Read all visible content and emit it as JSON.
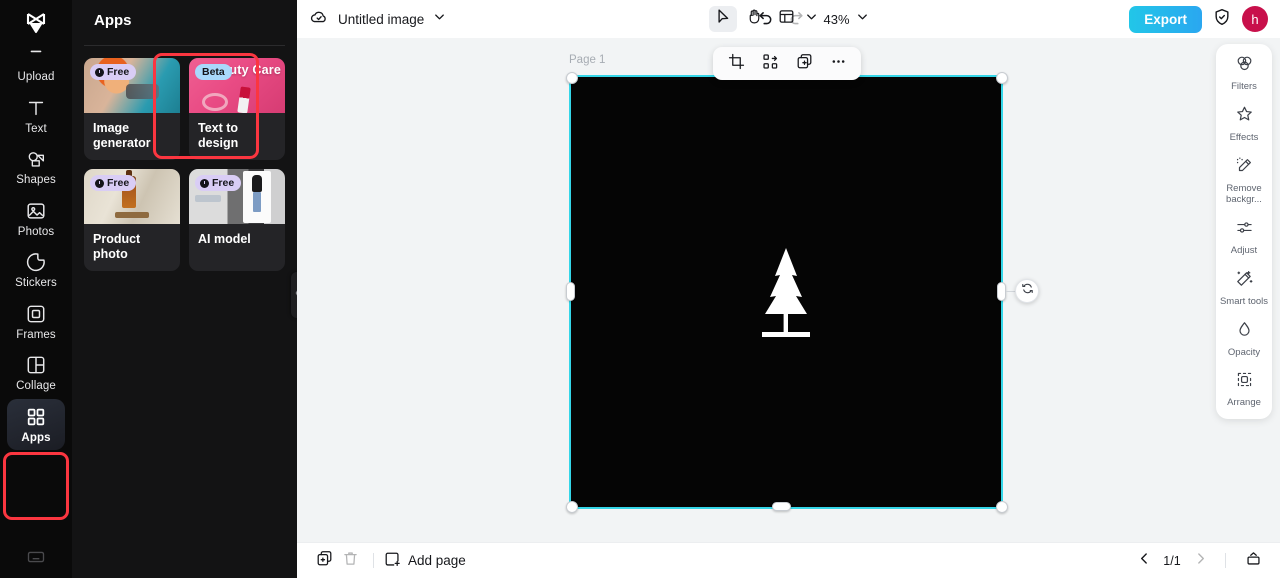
{
  "rail": {
    "logo_icon": "capcut-logo-icon",
    "items": [
      {
        "label": "Upload",
        "icon": "upload-icon",
        "active": false
      },
      {
        "label": "Text",
        "icon": "text-icon",
        "active": false
      },
      {
        "label": "Shapes",
        "icon": "shapes-icon",
        "active": false
      },
      {
        "label": "Photos",
        "icon": "photos-icon",
        "active": false
      },
      {
        "label": "Stickers",
        "icon": "stickers-icon",
        "active": false
      },
      {
        "label": "Frames",
        "icon": "frames-icon",
        "active": false
      },
      {
        "label": "Collage",
        "icon": "collage-icon",
        "active": false
      },
      {
        "label": "Apps",
        "icon": "apps-grid-icon",
        "active": true
      }
    ],
    "bottom_icon": "keyboard-icon",
    "highlight_color": "#fb3640"
  },
  "panel": {
    "title": "Apps",
    "collapse_icon": "chevron-left-icon",
    "cards": [
      {
        "label": "Image generator",
        "badge": "Free",
        "badge_type": "free",
        "badge_icon": "clock-icon",
        "thumb": "th-img-gen",
        "selected": true
      },
      {
        "label": "Text to design",
        "badge": "Beta",
        "badge_type": "beta",
        "badge_icon": "",
        "thumb": "th-text-des",
        "overlay_text": "Beauty Care",
        "selected": false
      },
      {
        "label": "Product photo",
        "badge": "Free",
        "badge_type": "free",
        "badge_icon": "clock-icon",
        "thumb": "th-prod",
        "selected": false
      },
      {
        "label": "AI model",
        "badge": "Free",
        "badge_type": "free",
        "badge_icon": "clock-icon",
        "thumb": "th-ai",
        "selected": false
      }
    ]
  },
  "topbar": {
    "cloud_icon": "cloud-save-icon",
    "doc_title": "Untitled image",
    "title_caret_icon": "chevron-down-icon",
    "tools": [
      {
        "name": "select-tool",
        "icon": "cursor-arrow-icon",
        "selected": true
      },
      {
        "name": "hand-tool",
        "icon": "hand-icon",
        "selected": false
      },
      {
        "name": "layout-tool",
        "icon": "layout-panel-icon",
        "selected": false
      }
    ],
    "layout_caret_icon": "chevron-down-icon",
    "zoom_level": "43%",
    "zoom_caret_icon": "chevron-down-icon",
    "undo_icon": "undo-icon",
    "redo_icon": "redo-icon",
    "export_label": "Export",
    "shield_icon": "shield-check-icon",
    "avatar_initial": "h",
    "avatar_color": "#c8104b",
    "export_color": "#22c6e8"
  },
  "canvas": {
    "page_label": "Page 1",
    "artboard_fill": "#050505",
    "selection_color": "#35d6e8",
    "artwork": "pine-tree-silhouette",
    "rotate_icon": "rotate-icon",
    "floating_toolbar": [
      {
        "name": "crop-button",
        "icon": "crop-icon"
      },
      {
        "name": "arrange-button",
        "icon": "organize-icon"
      },
      {
        "name": "duplicate-button",
        "icon": "duplicate-icon"
      },
      {
        "name": "more-button",
        "icon": "more-horizontal-icon"
      }
    ]
  },
  "dock": {
    "items": [
      {
        "label": "Filters",
        "icon": "filters-icon"
      },
      {
        "label": "Effects",
        "icon": "effects-icon"
      },
      {
        "label": "Remove backgr...",
        "icon": "remove-background-icon"
      },
      {
        "label": "Adjust",
        "icon": "adjust-sliders-icon"
      },
      {
        "label": "Smart tools",
        "icon": "smart-tools-icon"
      },
      {
        "label": "Opacity",
        "icon": "opacity-drop-icon"
      },
      {
        "label": "Arrange",
        "icon": "arrange-icon"
      }
    ]
  },
  "bottombar": {
    "duplicate_page_icon": "duplicate-page-icon",
    "delete_page_icon": "trash-icon",
    "add_page_icon": "add-page-icon",
    "add_page_label": "Add page",
    "prev_icon": "chevron-left-icon",
    "page_indicator": "1/1",
    "next_icon": "chevron-right-icon",
    "pages_panel_icon": "pages-panel-icon"
  }
}
